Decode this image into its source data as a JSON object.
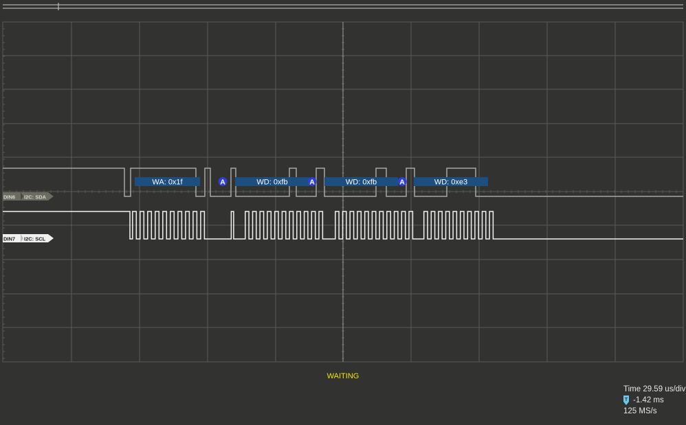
{
  "channels": [
    {
      "id": "DIN6",
      "protocol": "I2C: SDA",
      "badge_color": "#6b6b62",
      "text_color": "#d8d8d0"
    },
    {
      "id": "DIN7",
      "protocol": "I2C: SCL",
      "badge_color": "#f0f0f0",
      "text_color": "#1a1a1a"
    }
  ],
  "decode": [
    {
      "kind": "frame",
      "label": "WA: 0x1f"
    },
    {
      "kind": "ack",
      "label": "A"
    },
    {
      "kind": "frame",
      "label": "WD: 0xfb"
    },
    {
      "kind": "ack",
      "label": "A"
    },
    {
      "kind": "frame",
      "label": "WD: 0xfb"
    },
    {
      "kind": "ack",
      "label": "A"
    },
    {
      "kind": "frame",
      "label": "WD: 0xe3"
    }
  ],
  "status": {
    "text": "WAITING",
    "color": "#f2e600"
  },
  "info": {
    "timebase": "Time 29.59 us/div",
    "trigger_position": "-1.42 ms",
    "sample_rate": "125 MS/s",
    "trigger_icon": "trigger-marker-icon"
  },
  "colors": {
    "background": "#323230",
    "grid": "#5a5a58",
    "sda_trace": "#a8a8a8",
    "scl_trace": "#f2f2f2",
    "decode_box": "#1c4f80",
    "ack_circle": "#2e3fd8",
    "trigger_icon": "#6fc6e8"
  }
}
